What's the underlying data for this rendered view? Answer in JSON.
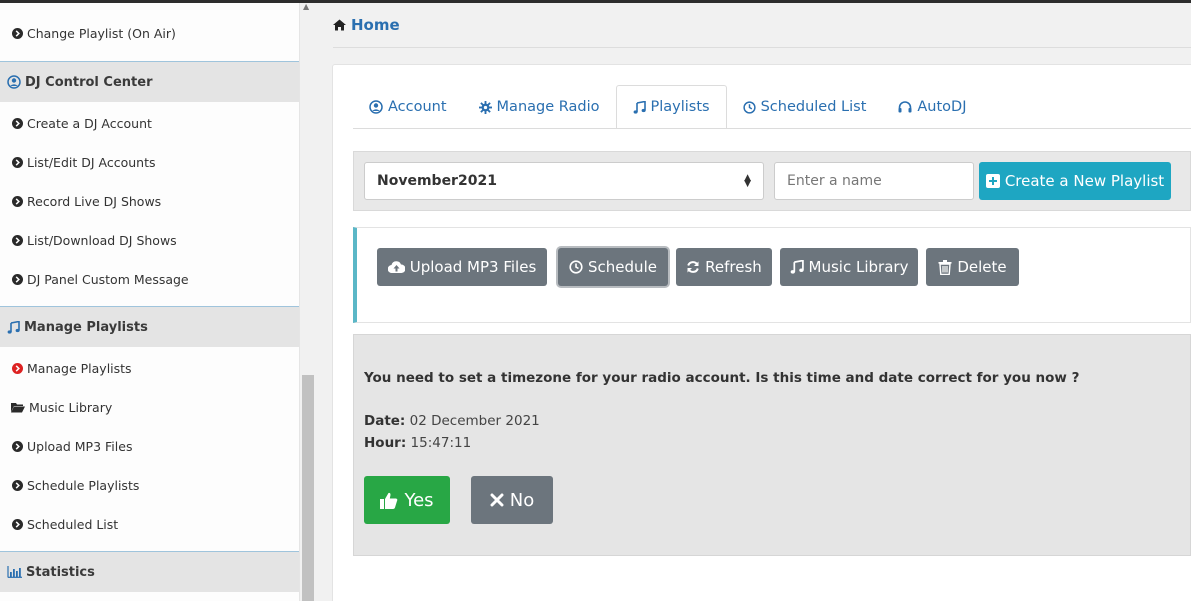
{
  "sidebar": {
    "items_top": [
      {
        "label": "Change Playlist (On Air)",
        "icon": "chevron-circle-right-icon"
      }
    ],
    "sections": [
      {
        "title": "DJ Control Center",
        "icon": "user-circle-icon",
        "items": [
          {
            "label": "Create a DJ Account",
            "icon": "chevron-circle-right-icon"
          },
          {
            "label": "List/Edit DJ Accounts",
            "icon": "chevron-circle-right-icon"
          },
          {
            "label": "Record Live DJ Shows",
            "icon": "chevron-circle-right-icon"
          },
          {
            "label": "List/Download DJ Shows",
            "icon": "chevron-circle-right-icon"
          },
          {
            "label": "DJ Panel Custom Message",
            "icon": "chevron-circle-right-icon"
          }
        ]
      },
      {
        "title": "Manage Playlists",
        "icon": "music-note-icon",
        "items": [
          {
            "label": "Manage Playlists",
            "icon": "chevron-circle-right-red-icon"
          },
          {
            "label": "Music Library",
            "icon": "folder-open-icon"
          },
          {
            "label": "Upload MP3 Files",
            "icon": "chevron-circle-right-icon"
          },
          {
            "label": "Schedule Playlists",
            "icon": "chevron-circle-right-icon"
          },
          {
            "label": "Scheduled List",
            "icon": "chevron-circle-right-icon"
          }
        ]
      },
      {
        "title": "Statistics",
        "icon": "bar-chart-icon",
        "items": []
      }
    ]
  },
  "breadcrumb": {
    "label": "Home",
    "icon": "home-icon"
  },
  "tabs": [
    {
      "label": "Account",
      "icon": "user-circle-icon",
      "active": false
    },
    {
      "label": "Manage Radio",
      "icon": "gear-icon",
      "active": false
    },
    {
      "label": "Playlists",
      "icon": "music-note-icon",
      "active": true
    },
    {
      "label": "Scheduled List",
      "icon": "clock-icon",
      "active": false
    },
    {
      "label": "AutoDJ",
      "icon": "headphones-icon",
      "active": false
    }
  ],
  "playlist_bar": {
    "selected_playlist": "November2021",
    "name_placeholder": "Enter a name",
    "create_label": "Create a New Playlist"
  },
  "actions": {
    "upload": "Upload MP3 Files",
    "schedule": "Schedule",
    "refresh": "Refresh",
    "music_library": "Music Library",
    "delete": "Delete"
  },
  "timezone": {
    "message": "You need to set a timezone for your radio account. Is this time and date correct for you now ?",
    "date_label": "Date:",
    "date_value": "02 December 2021",
    "hour_label": "Hour:",
    "hour_value": "15:47:11",
    "yes_label": "Yes",
    "no_label": "No"
  },
  "colors": {
    "link_blue": "#2a6fb0",
    "info_teal": "#1ea6c2",
    "secondary_gray": "#6c757d",
    "success_green": "#28a745",
    "danger_red": "#dd2222"
  }
}
